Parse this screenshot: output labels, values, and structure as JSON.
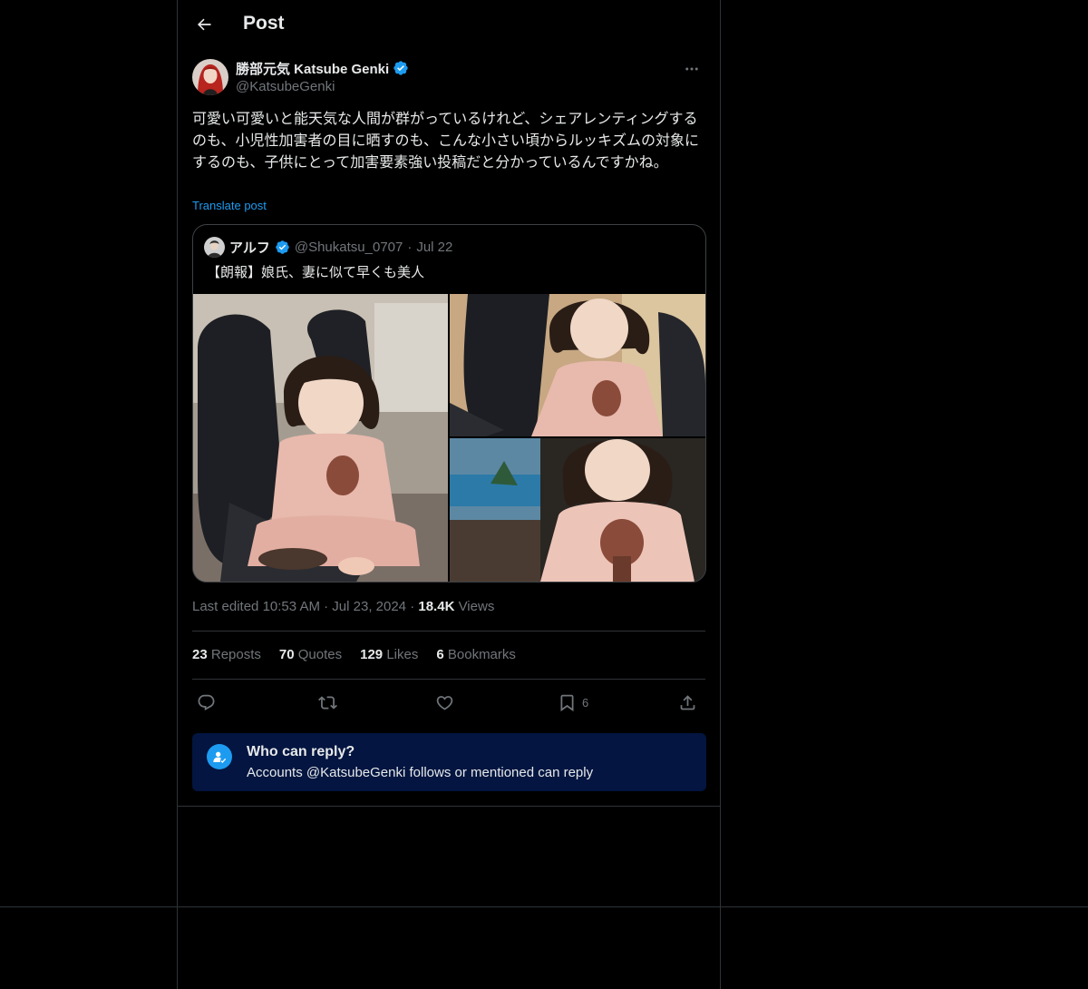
{
  "header": {
    "title": "Post"
  },
  "author": {
    "display_name": "勝部元気 Katsube Genki",
    "handle": "@KatsubeGenki"
  },
  "post": {
    "text": "可愛い可愛いと能天気な人間が群がっているけれど、シェアレンティングするのも、小児性加害者の目に晒すのも、こんな小さい頃からルッキズムの対象にするのも、子供にとって加害要素強い投稿だと分かっているんですかね。",
    "translate_label": "Translate post"
  },
  "quoted_post": {
    "display_name": "アルフ",
    "handle": "@Shukatsu_0707",
    "separator": "·",
    "date": "Jul 22",
    "text": "【朗報】娘氏、妻に似て早くも美人"
  },
  "meta": {
    "edited_label": "Last edited",
    "time": "10:53 AM",
    "separator": "·",
    "date": "Jul 23, 2024",
    "views_count": "18.4K",
    "views_label": "Views"
  },
  "stats": {
    "reposts": {
      "count": "23",
      "label": "Reposts"
    },
    "quotes": {
      "count": "70",
      "label": "Quotes"
    },
    "likes": {
      "count": "129",
      "label": "Likes"
    },
    "bookmarks": {
      "count": "6",
      "label": "Bookmarks"
    }
  },
  "actions": {
    "bookmark_count": "6",
    "icons": [
      "reply-icon",
      "repost-icon",
      "like-icon",
      "bookmark-icon",
      "share-icon"
    ]
  },
  "reply_restriction": {
    "title": "Who can reply?",
    "prefix": "Accounts",
    "mention": "@KatsubeGenki",
    "suffix": "follows or mentioned can reply"
  },
  "colors": {
    "background": "#000000",
    "text_primary": "#e7e9ea",
    "text_secondary": "#71767b",
    "accent": "#1d9bf0",
    "verified_badge": "#1d9bf0",
    "reply_box": "#031540",
    "border": "#2f3336"
  }
}
